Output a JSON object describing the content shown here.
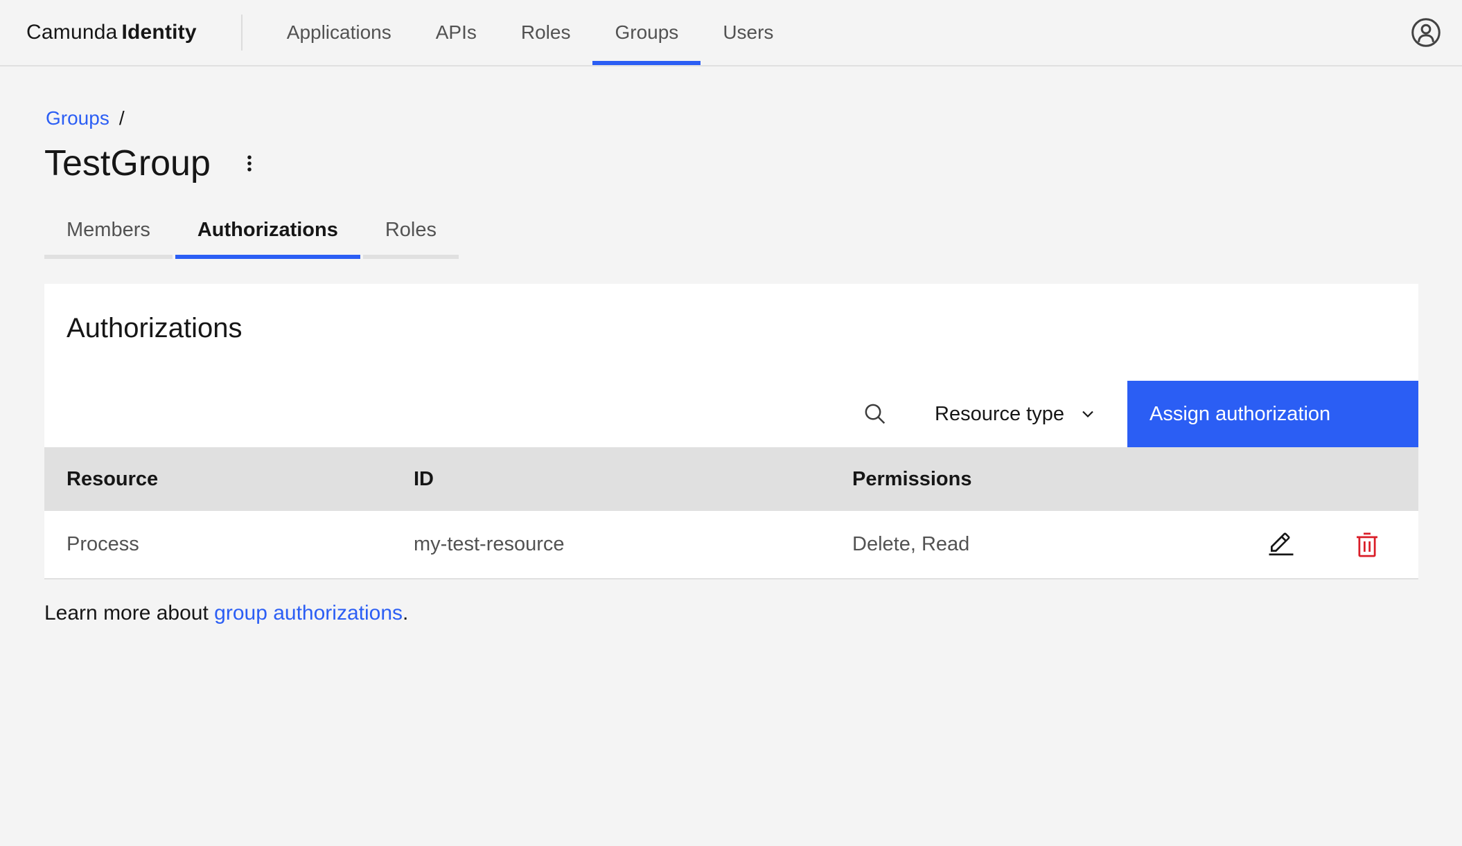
{
  "colors": {
    "accent_blue": "#2b5ef4",
    "danger_red": "#da1e28",
    "page_background": "#f4f4f4",
    "card_background": "#ffffff",
    "table_header_background": "#e0e0e0",
    "text_primary": "#161616",
    "text_secondary": "#525252",
    "border": "#e0e0e0"
  },
  "header": {
    "brand": {
      "name": "Camunda",
      "product": "Identity"
    },
    "nav": [
      {
        "label": "Applications",
        "active": false
      },
      {
        "label": "APIs",
        "active": false
      },
      {
        "label": "Roles",
        "active": false
      },
      {
        "label": "Groups",
        "active": true
      },
      {
        "label": "Users",
        "active": false
      }
    ],
    "user_icon": "user-avatar"
  },
  "breadcrumb": {
    "items": [
      {
        "label": "Groups"
      }
    ],
    "separator": "/"
  },
  "page": {
    "title": "TestGroup",
    "overflow_menu_icon": "overflow-menu-vertical"
  },
  "tabs": [
    {
      "label": "Members",
      "active": false
    },
    {
      "label": "Authorizations",
      "active": true
    },
    {
      "label": "Roles",
      "active": false
    }
  ],
  "card": {
    "heading": "Authorizations",
    "toolbar": {
      "search_icon": "search",
      "filter_label": "Resource type",
      "filter_chevron_icon": "chevron-down",
      "assign_button_label": "Assign authorization"
    },
    "table": {
      "columns": [
        "Resource",
        "ID",
        "Permissions"
      ],
      "rows": [
        {
          "resource": "Process",
          "id": "my-test-resource",
          "permissions": "Delete, Read",
          "actions": [
            "edit",
            "delete"
          ]
        }
      ]
    }
  },
  "footer": {
    "learn_more_prefix": "Learn more about ",
    "learn_more_link": "group authorizations",
    "learn_more_suffix": "."
  }
}
